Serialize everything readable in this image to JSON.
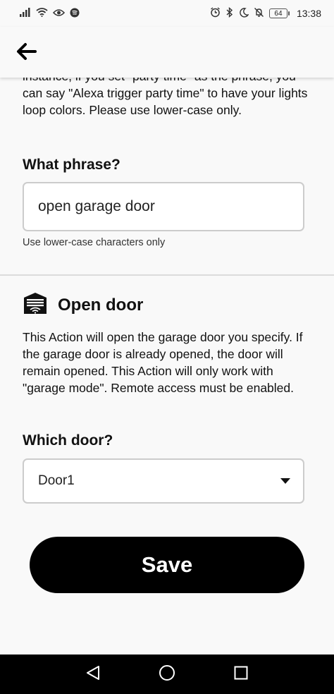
{
  "status_bar": {
    "time": "13:38",
    "battery": "64",
    "left_icons": [
      "signal-icon",
      "wifi-icon",
      "eye-icon",
      "spotify-icon"
    ],
    "right_icons": [
      "alarm-icon",
      "bluetooth-icon",
      "moon-icon",
      "mute-icon",
      "battery-icon"
    ]
  },
  "header": {
    "back_icon": "arrow-left-icon"
  },
  "phrase_section": {
    "intro_text": "instance, if you set \"party time\" as the phrase, you can say \"Alexa trigger party time\" to have your lights loop colors. Please use lower-case only.",
    "label": "What phrase?",
    "value": "open garage door",
    "helper": "Use lower-case characters only"
  },
  "action_section": {
    "icon": "garage-door-icon",
    "title": "Open door",
    "description": "This Action will open the garage door you specify. If the garage door is already opened, the door will remain opened. This Action will only work with \"garage mode\". Remote access must be enabled.",
    "door_label": "Which door?",
    "door_selected": "Door1"
  },
  "save_label": "Save",
  "nav_bar": {
    "icons": [
      "back-triangle-icon",
      "home-circle-icon",
      "recents-square-icon"
    ]
  },
  "colors": {
    "background": "#f9f9f9",
    "button": "#000000",
    "button_text": "#ffffff",
    "field_border": "#cccccc",
    "nav_bar": "#000000"
  }
}
